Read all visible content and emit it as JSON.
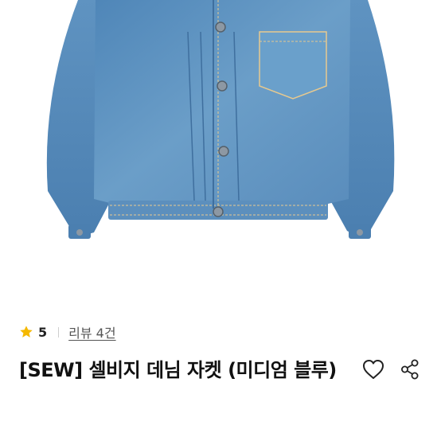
{
  "product": {
    "image_icon": "denim-jacket-photo",
    "rating": "5",
    "review_link": "리뷰 4건",
    "title": "[SEW] 셀비지 데님 자켓 (미디엄 블루)"
  },
  "actions": {
    "like_icon": "heart-outline-icon",
    "share_icon": "share-icon"
  },
  "colors": {
    "star": "#f5b800",
    "denim": "#5f92bf",
    "text": "#111111",
    "muted": "#555555"
  }
}
